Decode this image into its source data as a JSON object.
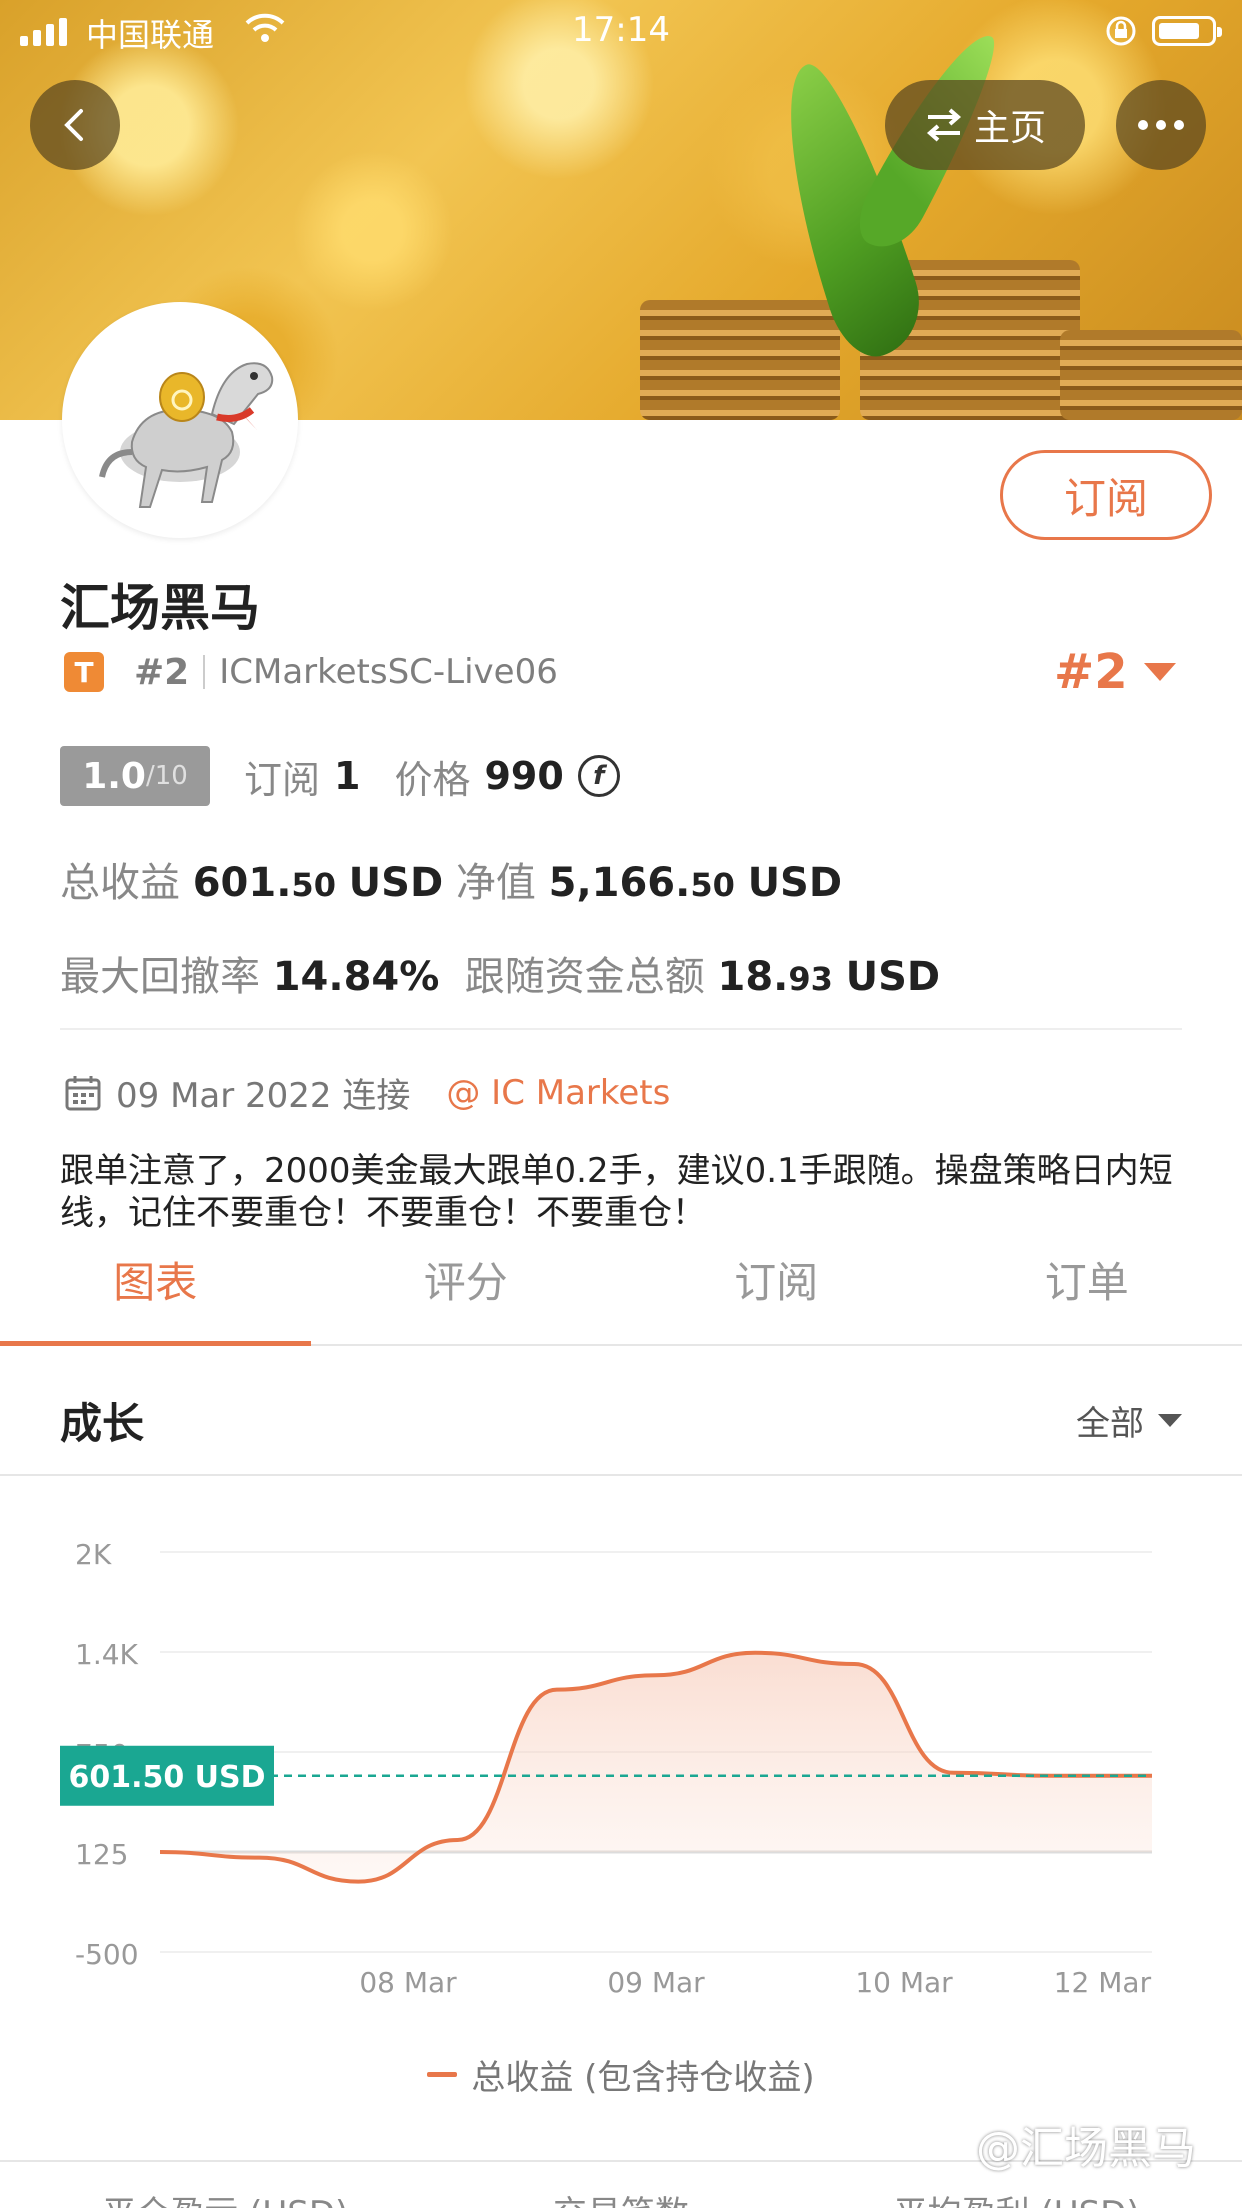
{
  "status_bar": {
    "carrier": "中国联通",
    "time": "17:14"
  },
  "header": {
    "home_label": "主页"
  },
  "profile": {
    "name": "汇场黑马",
    "badge": "T",
    "rank_small": "#2",
    "server": "ICMarketsSC-Live06",
    "rank_big": "#2",
    "subscribe_label": "订阅"
  },
  "stats": {
    "score": "1.0",
    "score_max": "/10",
    "subscribers_label": "订阅",
    "subscribers": "1",
    "price_label": "价格",
    "price": "990",
    "total_profit_label": "总收益",
    "total_profit_int": "601.",
    "total_profit_dec": "50",
    "total_profit_unit": "USD",
    "equity_label": "净值",
    "equity_int": "5,166.",
    "equity_dec": "50",
    "equity_unit": "USD",
    "max_drawdown_label": "最大回撤率",
    "max_drawdown": "14.84%",
    "follow_funds_label": "跟随资金总额",
    "follow_funds_int": "18.",
    "follow_funds_dec": "93",
    "follow_funds_unit": "USD"
  },
  "info": {
    "date": "09 Mar 2022 连接",
    "broker": "@ IC Markets",
    "description": "跟单注意了，2000美金最大跟单0.2手，建议0.1手跟随。操盘策略日内短线，记住不要重仓！不要重仓！不要重仓！"
  },
  "tabs": [
    {
      "label": "图表",
      "active": true
    },
    {
      "label": "评分",
      "active": false
    },
    {
      "label": "订阅",
      "active": false
    },
    {
      "label": "订单",
      "active": false
    }
  ],
  "growth": {
    "title": "成长",
    "range": "全部"
  },
  "chart_data": {
    "type": "area",
    "y_ticks": [
      "2K",
      "1.4K",
      "750",
      "125",
      "-500"
    ],
    "ylim": [
      -500,
      2000
    ],
    "x_ticks": [
      "08 Mar",
      "09 Mar",
      "10 Mar",
      "12 Mar"
    ],
    "series": [
      {
        "name": "总收益 (包含持仓收益)",
        "color": "#e8774a",
        "points": [
          {
            "x": 0.0,
            "y": 125
          },
          {
            "x": 0.1,
            "y": 90
          },
          {
            "x": 0.2,
            "y": -60
          },
          {
            "x": 0.3,
            "y": 200
          },
          {
            "x": 0.4,
            "y": 1140
          },
          {
            "x": 0.5,
            "y": 1230
          },
          {
            "x": 0.6,
            "y": 1370
          },
          {
            "x": 0.7,
            "y": 1300
          },
          {
            "x": 0.8,
            "y": 620
          },
          {
            "x": 0.9,
            "y": 601.5
          },
          {
            "x": 1.0,
            "y": 601.5
          }
        ]
      }
    ],
    "current_label": "601.50 USD",
    "current_value": 601.5,
    "current_color": "#1aa792"
  },
  "legend": {
    "label": "总收益 (包含持仓收益)"
  },
  "bottom_columns": [
    "平仓盈亏 (USD)",
    "交易笔数",
    "平均盈利 (USD)"
  ],
  "watermark": "@汇场黑马",
  "colors": {
    "accent": "#e8774a",
    "teal": "#1aa792"
  }
}
